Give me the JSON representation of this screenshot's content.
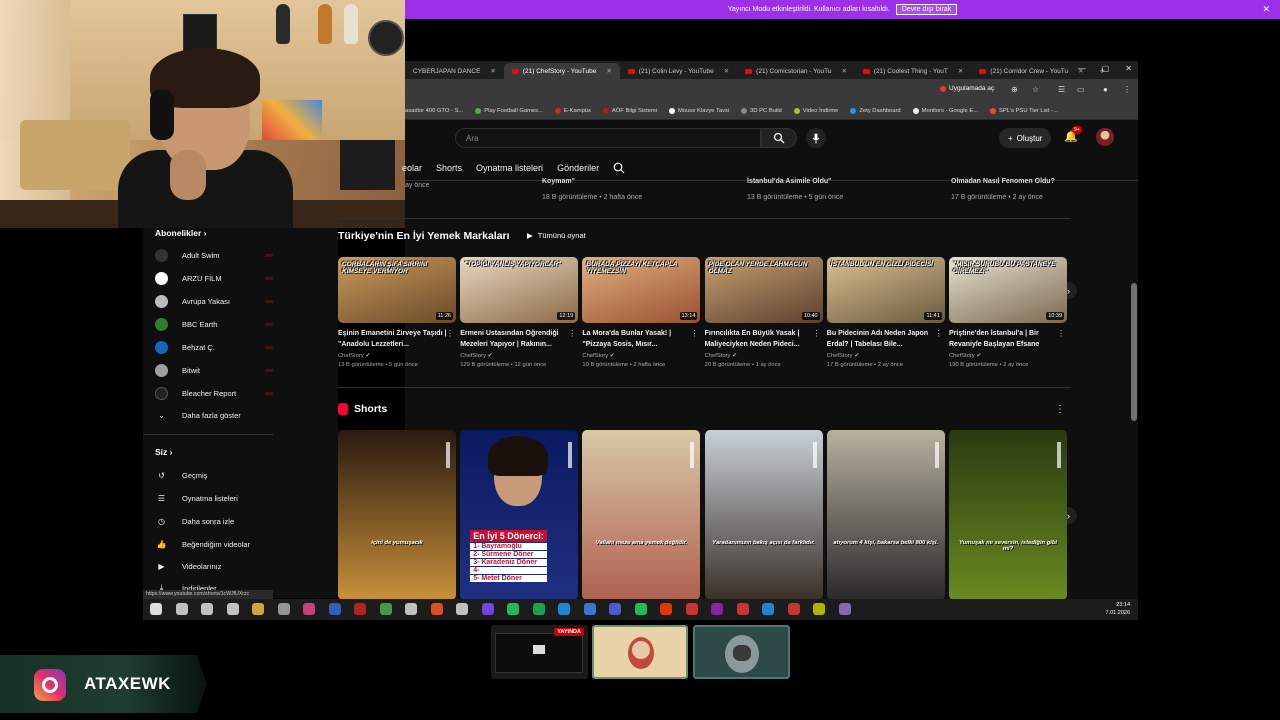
{
  "banner": {
    "text": "Yayıncı Modu etkinleştirildi. Kullanıcı adları kısaltıldı.",
    "button": "Devre dışı bırak"
  },
  "tabs": [
    {
      "label": "CYBERJAPAN DANCE",
      "active": false
    },
    {
      "label": "(21) ChefStory - YouTube",
      "active": true
    },
    {
      "label": "(21) Colin Levy - YouTube",
      "active": false
    },
    {
      "label": "(21) Comicstorian - YouTu",
      "active": false
    },
    {
      "label": "(21) Coolest Thing - YouT",
      "active": false
    },
    {
      "label": "(21) Corridor Crew - YouTu",
      "active": false
    }
  ],
  "addr": {
    "app_button": "Uygulamada aç"
  },
  "bookmarks": [
    "asadior 400 GTO - S...",
    "Play Football Games...",
    "E-Kampüs",
    "AÖF Bilgi Sistemi",
    "Mouse Klavye Tavsi",
    "3D PC Build",
    "Video İndirme",
    "Zety Dashboard",
    "Monitors - Google E...",
    "SPL's PSU Tier List -..."
  ],
  "ytheader": {
    "search_placeholder": "Ara",
    "create_label": "Oluştur",
    "notif_badge": "9+"
  },
  "channel_nav": [
    "eolar",
    "Shorts",
    "Oynatma listeleri",
    "Gönderiler"
  ],
  "sidebar": {
    "subs_heading": "Abonelikler",
    "subs": [
      {
        "label": "Adult Swim",
        "color": "#333333"
      },
      {
        "label": "ARZU FİLM",
        "color": "#ffffff"
      },
      {
        "label": "Avrupa Yakası",
        "color": "#bbbbbb"
      },
      {
        "label": "BBC Earth",
        "color": "#2e7d32"
      },
      {
        "label": "Behzat Ç.",
        "color": "#1565c0"
      },
      {
        "label": "Bitwit",
        "color": "#9e9e9e"
      },
      {
        "label": "Bleacher Report",
        "color": "#222222"
      }
    ],
    "show_more": "Daha fazla göster",
    "you_heading": "Siz",
    "you_items": [
      "Geçmiş",
      "Oynatma listeleri",
      "Daha sonra izle",
      "Beğendiğim videolar",
      "Videolarınız",
      "İndirilenler"
    ]
  },
  "top_row": {
    "titles": [
      "Koymam\"",
      "İstanbul'da Asimile Oldu\"",
      "Olmadan Nasıl Fenomen Oldu?"
    ],
    "metas": [
      "18 B görüntüleme • 2 hafta önce",
      "13 B görüntüleme • 5 gün önce",
      "17 B görüntüleme • 2 ay önce"
    ],
    "first_meta": "ay önce"
  },
  "section1": {
    "title": "Türkiye'nin En İyi Yemek Markaları",
    "play_all": "Tümünü oynat"
  },
  "videos": [
    {
      "cap": "ÇORBALARIN ŞİFA SIRRINI KİMSEYE VERMİYOR",
      "duration": "11:26",
      "title": "Eşinin Emanetini Zirveye Taşıdı | \"Anadolu Lezzetleri...",
      "channel": "ChefStory",
      "meta": "13 B görüntüleme • 5 gün önce",
      "c1": "#6b4a2a",
      "c2": "#c99a5a"
    },
    {
      "cap": "\"TOPIĞI YANLIŞ YAPIYORLAR\"",
      "duration": "12:19",
      "title": "Ermeni Ustasından Öğrendiği Mezeleri Yapıyor | Rakının...",
      "channel": "ChefStory",
      "meta": "129 B görüntüleme • 12 gün önce",
      "c1": "#8a6a48",
      "c2": "#e8d8c0"
    },
    {
      "cap": "BURADA PİZZAYI KETÇAPLA YİYEMEZSİN",
      "duration": "13:14",
      "title": "La Mora'da Bunlar Yasak! | \"Pizzaya Sosis, Mısır...",
      "channel": "ChefStory",
      "meta": "10 B görüntüleme • 2 hafta önce",
      "c1": "#9a5030",
      "c2": "#e0b080"
    },
    {
      "cap": "PİDE OLAN YERDE LAHMACUN OLMAZ",
      "duration": "10:40",
      "title": "Fırıncılıkta En Büyük Yasak | Maliyeciyken Neden Pideci...",
      "channel": "ChefStory",
      "meta": "20 B görüntüleme • 1 ay önce",
      "c1": "#5a4030",
      "c2": "#c8a070"
    },
    {
      "cap": "İSTANBUL'UN EN GİZLİ PİDECİSİ",
      "duration": "11:41",
      "title": "Bu Pidecinin Adı Neden Japon Erdal? | Tabelası Bile...",
      "channel": "ChefStory",
      "meta": "17 B görüntüleme • 2 ay önce",
      "c1": "#6a5a40",
      "c2": "#d8c090"
    },
    {
      "cap": "\"MISIR ŞURUBU BU PASTANEYE GİREMEZ!\"",
      "duration": "10:39",
      "title": "Priştine'den İstanbul'a | Bir Revaniyle Başlayan Efsane",
      "channel": "ChefStory",
      "meta": "190 B görüntüleme • 2 ay önce",
      "c1": "#7a6a50",
      "c2": "#e8e0d0"
    }
  ],
  "shorts_title": "Shorts",
  "shorts": [
    {
      "cap": "içini de yumuşacık",
      "c1": "#2a1a10",
      "c2": "#c8903a"
    },
    {
      "cap": "",
      "c1": "#0a1a60",
      "c2": "#203080"
    },
    {
      "cap": "Vallahi meze ama yemek değildir.",
      "c1": "#d8c8a8",
      "c2": "#b06050"
    },
    {
      "cap": "Yaradanımızın bakış açısı da farklıdır.",
      "c1": "#c8d0d8",
      "c2": "#3a3028"
    },
    {
      "cap": "atıyorum 4 kişi, bakarsa belki 800 kişi.",
      "c1": "#b8b0a0",
      "c2": "#2a2a2a"
    },
    {
      "cap": "Yumuşak mı seversin, istediğin gibi mi?",
      "c1": "#2a3a10",
      "c2": "#6a8a20"
    }
  ],
  "doner_list": {
    "heading": "En İyi 5 Dönerci:",
    "items": [
      "1- Bayramoğlu",
      "2- Sürmene Döner",
      "3- Karadeniz Döner",
      "4-",
      "5- Metet Döner"
    ]
  },
  "url_tooltip": "https://www.youtube.com/shorts/1cWJfUXrzc",
  "taskbar": {
    "time": "23:14",
    "date": "7.01.2026"
  },
  "preview": {
    "live_label": "YAYINDA"
  },
  "insta": {
    "handle": "ATAXEWK"
  }
}
